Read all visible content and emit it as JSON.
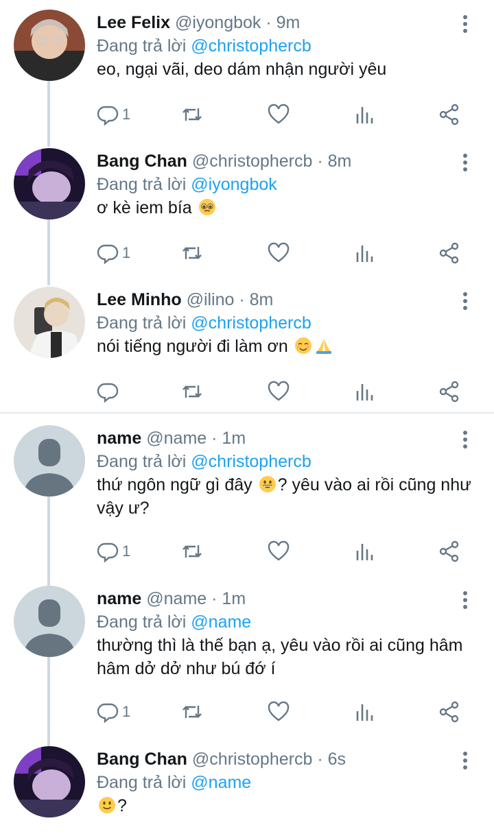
{
  "tweets": [
    {
      "name": "Lee Felix",
      "handle": "@iyongbok",
      "time": "9m",
      "reply_prefix": "Đang trả lời",
      "reply_to": "@christophercb",
      "text": "eo, ngại vãi, deo dám nhận người yêu",
      "replies": "1"
    },
    {
      "name": "Bang Chan",
      "handle": "@christophercb",
      "time": "8m",
      "reply_prefix": "Đang trả lời",
      "reply_to": "@iyongbok",
      "text_before": "ơ kè iem bía",
      "text_after": "",
      "replies": "1"
    },
    {
      "name": "Lee Minho",
      "handle": "@ilino",
      "time": "8m",
      "reply_prefix": "Đang trả lời",
      "reply_to": "@christophercb",
      "text_before": "nói tiếng người đi làm ơn",
      "replies": ""
    },
    {
      "name": "name",
      "handle": "@name",
      "time": "1m",
      "reply_prefix": "Đang trả lời",
      "reply_to": "@christophercb",
      "text_before": "thứ ngôn ngữ gì đây",
      "text_after": "? yêu vào ai rồi cũng như vậy ư?",
      "replies": "1"
    },
    {
      "name": "name",
      "handle": "@name",
      "time": "1m",
      "reply_prefix": "Đang trả lời",
      "reply_to": "@name",
      "text": "thường thì là thế bạn ạ, yêu vào rồi ai cũng hâm hâm dở dở như bú đớ í",
      "replies": "1"
    },
    {
      "name": "Bang Chan",
      "handle": "@christophercb",
      "time": "6s",
      "reply_prefix": "Đang trả lời",
      "reply_to": "@name",
      "text_before": "",
      "text_after": "?"
    }
  ],
  "dot": "·",
  "icons": {
    "reply": "reply-icon",
    "retweet": "retweet-icon",
    "like": "heart-icon",
    "analytics": "analytics-icon",
    "share": "share-icon",
    "more": "more-vertical-icon"
  },
  "colors": {
    "mention": "#1da1f2",
    "secondary": "#657786",
    "thread_line": "#cfd9de"
  }
}
